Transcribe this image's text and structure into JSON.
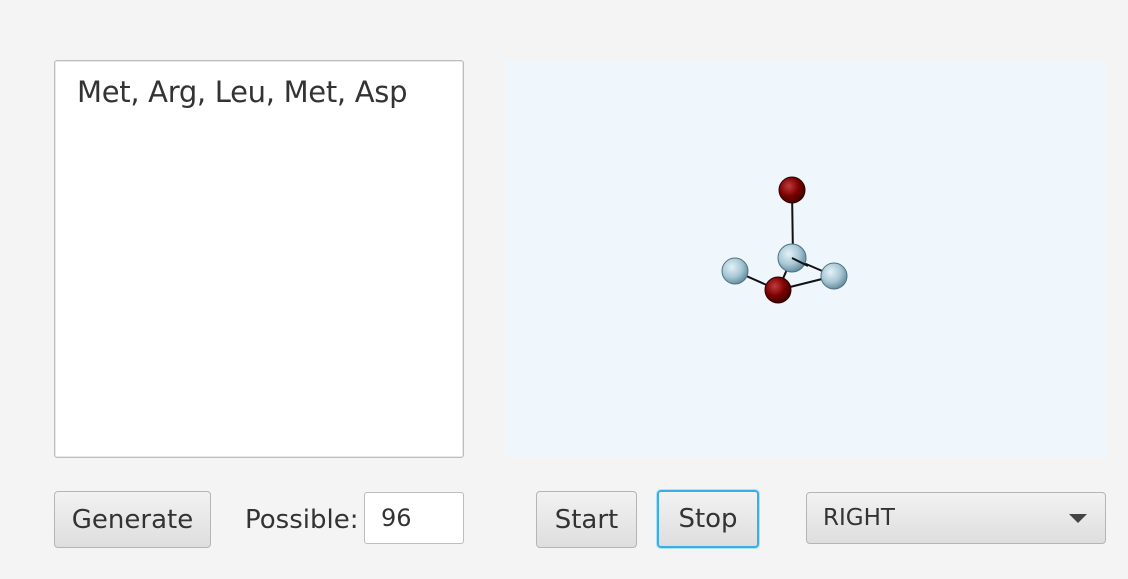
{
  "sequence": {
    "text": "Met, Arg, Leu, Met, Asp"
  },
  "molecule_viewer": {
    "background_color": "#eff7fd",
    "atom_colors": {
      "oxygen": "#7a0000",
      "carbon": "#a8c8d6"
    },
    "atoms": [
      {
        "element": "oxygen"
      },
      {
        "element": "carbon"
      },
      {
        "element": "carbon"
      },
      {
        "element": "oxygen"
      },
      {
        "element": "carbon"
      }
    ]
  },
  "controls": {
    "generate_label": "Generate",
    "possible_label": "Possible:",
    "possible_value": "96",
    "start_label": "Start",
    "stop_label": "Stop",
    "direction_value": "RIGHT",
    "focus_color": "#3aaee8"
  }
}
